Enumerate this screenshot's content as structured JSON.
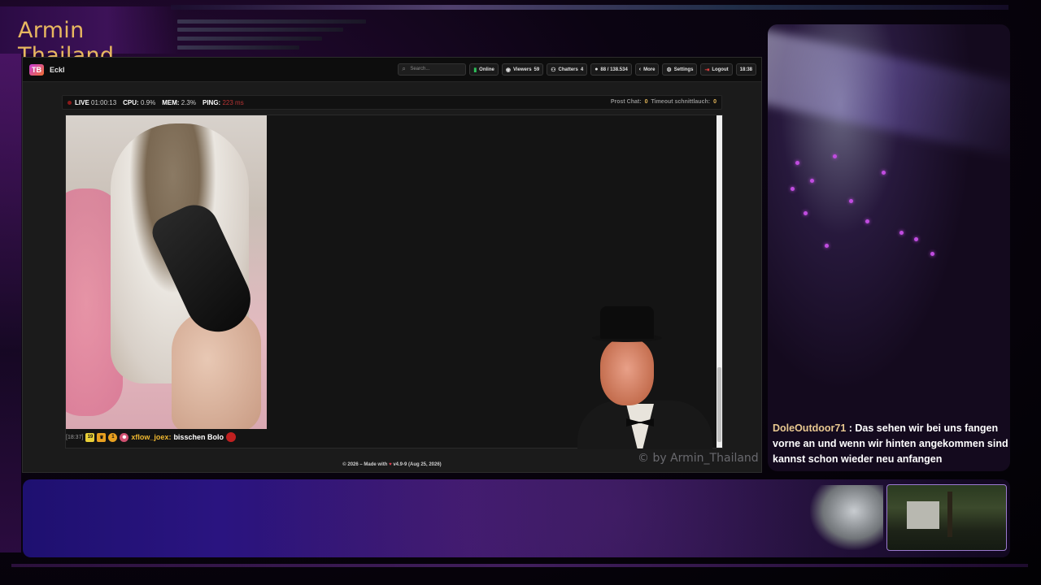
{
  "overlay": {
    "title": "Armin Thailand",
    "copyright": "© by Armin_Thailand",
    "chat": {
      "user": "DoleOutdoor71",
      "separator": " : ",
      "message": "Das sehen wir bei uns fangen vorne an und wenn wir hinten angekommen sind kannst schon wieder neu anfangen"
    }
  },
  "app": {
    "brand": "Eckl",
    "logo_text": "TB",
    "nav": {
      "search_placeholder": "Search...",
      "online_label": "Online",
      "viewers_label": "Viewers",
      "viewers_count": "59",
      "chatters_label": "Chatters",
      "chatters_count": "4",
      "messages_count": "88 / 138.534",
      "more_label": "More",
      "settings_label": "Settings",
      "logout_label": "Logout",
      "clock": "18:38"
    },
    "status": {
      "live_label": "LIVE",
      "live_time": "01:00:13",
      "cpu_label": "CPU:",
      "cpu_value": "0.9%",
      "mem_label": "MEM:",
      "mem_value": "2.3%",
      "ping_label": "PING:",
      "ping_value": "223 ms",
      "prost_label": "Prost Chat:",
      "prost_value": "0",
      "timeout_label": "Timeout schnittlauch:",
      "timeout_value": "0"
    },
    "chat_message": {
      "timestamp": "[18:37]",
      "badge_number": "19",
      "badge_sub": "1",
      "user": "xflow_joex",
      "message": "bisschen Bolo"
    },
    "footer": {
      "prefix": "© 2026 – Made with",
      "suffix": "v4.9-9 (Aug 25, 2026)"
    }
  },
  "colors": {
    "accent_gold": "#e8b860",
    "online_green": "#2ec05a",
    "ping_red": "#b83434",
    "username_gold": "#f0b830"
  }
}
